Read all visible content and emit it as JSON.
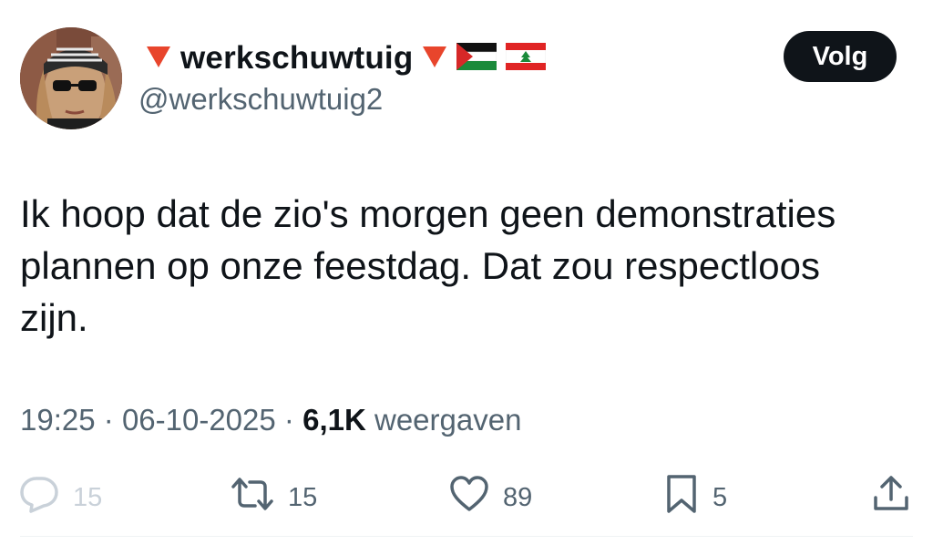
{
  "author": {
    "display_name": "werkschuwtuig",
    "handle": "@werkschuwtuig2",
    "name_emojis": [
      "red-triangle-down-icon",
      "red-triangle-down-icon",
      "palestine-flag-icon",
      "lebanon-flag-icon"
    ]
  },
  "follow_button": {
    "label": "Volg"
  },
  "tweet": {
    "text": "Ik hoop dat de zio's morgen geen demonstraties plannen op onze feestdag. Dat zou respectloos zijn."
  },
  "meta": {
    "time": "19:25",
    "separator": "·",
    "date": "06-10-2025",
    "views_count": "6,1K",
    "views_label": "weergaven"
  },
  "actions": {
    "replies": "15",
    "retweets": "15",
    "likes": "89",
    "bookmarks": "5"
  },
  "colors": {
    "text": "#0f1419",
    "secondary": "#536471",
    "button_bg": "#0f1419",
    "button_text": "#ffffff"
  }
}
